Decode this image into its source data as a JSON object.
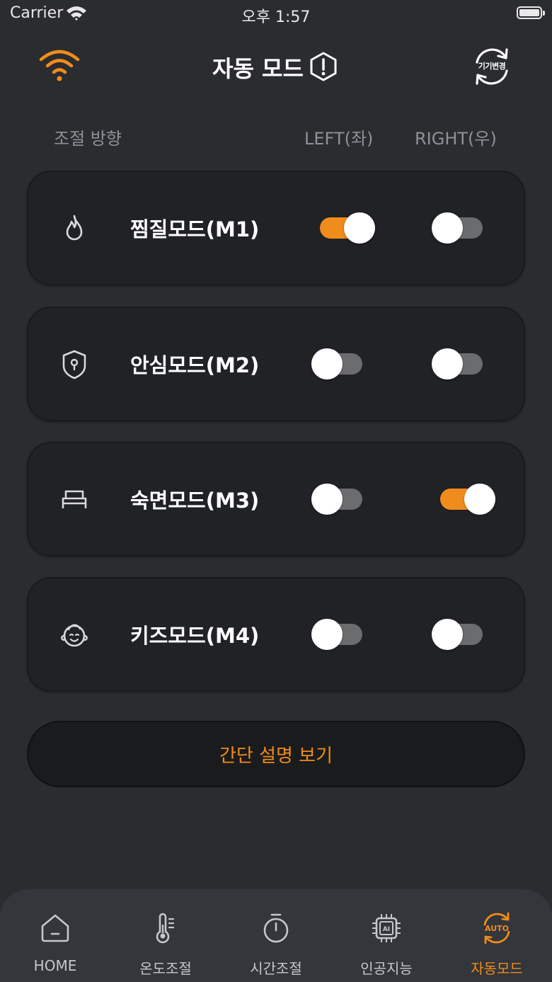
{
  "status_bar": {
    "carrier": "Carrier",
    "time": "오후 1:57"
  },
  "header": {
    "title": "자동 모드",
    "device_change_label": "기기변경"
  },
  "columns": {
    "direction": "조절 방향",
    "left": "LEFT(좌)",
    "right": "RIGHT(우)"
  },
  "modes": [
    {
      "label": "찜질모드(M1)",
      "icon": "flame-icon",
      "left_on": true,
      "right_on": false
    },
    {
      "label": "안심모드(M2)",
      "icon": "shield-icon",
      "left_on": false,
      "right_on": false
    },
    {
      "label": "숙면모드(M3)",
      "icon": "bed-icon",
      "left_on": false,
      "right_on": true
    },
    {
      "label": "키즈모드(M4)",
      "icon": "baby-face-icon",
      "left_on": false,
      "right_on": false
    }
  ],
  "explain_button": {
    "label": "간단 설명 보기"
  },
  "nav": {
    "items": [
      {
        "label": "HOME",
        "icon": "home-icon"
      },
      {
        "label": "온도조절",
        "icon": "thermometer-icon"
      },
      {
        "label": "시간조절",
        "icon": "stopwatch-icon"
      },
      {
        "label": "인공지능",
        "icon": "ai-chip-icon"
      },
      {
        "label": "자동모드",
        "icon": "auto-cycle-icon",
        "icon_text": "AUTO"
      }
    ],
    "active_index": 4
  },
  "colors": {
    "accent": "#f08c1c",
    "background": "#2a2c2f",
    "card": "#202225",
    "nav": "#33363a",
    "muted_text": "#8e9196"
  }
}
